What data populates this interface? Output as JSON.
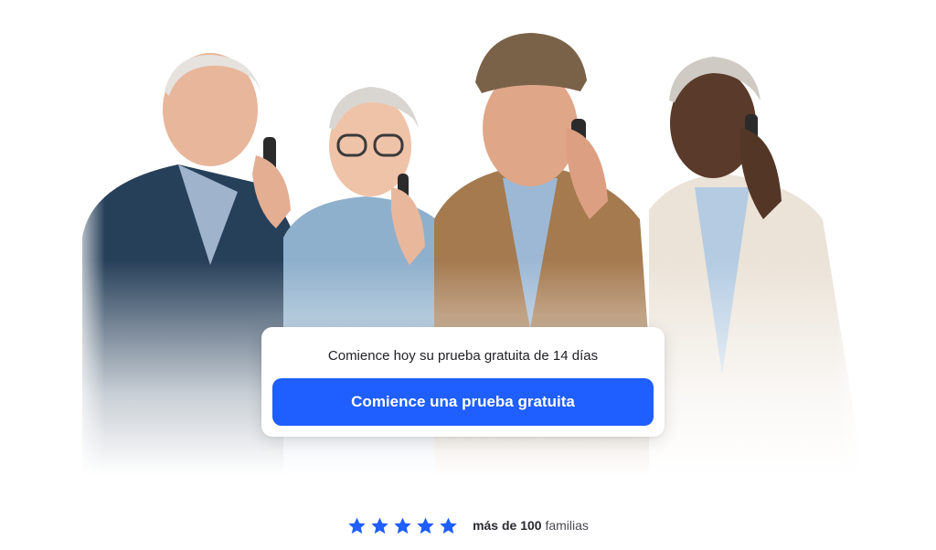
{
  "hero": {
    "image_icon": "four-seniors-on-phones-photo"
  },
  "cta": {
    "text": "Comience hoy su prueba gratuita de 14 días",
    "button_label": "Comience una prueba gratuita"
  },
  "rating": {
    "stars": 5,
    "strong_text": "más de 100",
    "suffix_text": " familias",
    "star_icon": "star-icon"
  },
  "colors": {
    "accent": "#1f5eff",
    "star": "#1f5eff",
    "text": "#1f1f24"
  }
}
